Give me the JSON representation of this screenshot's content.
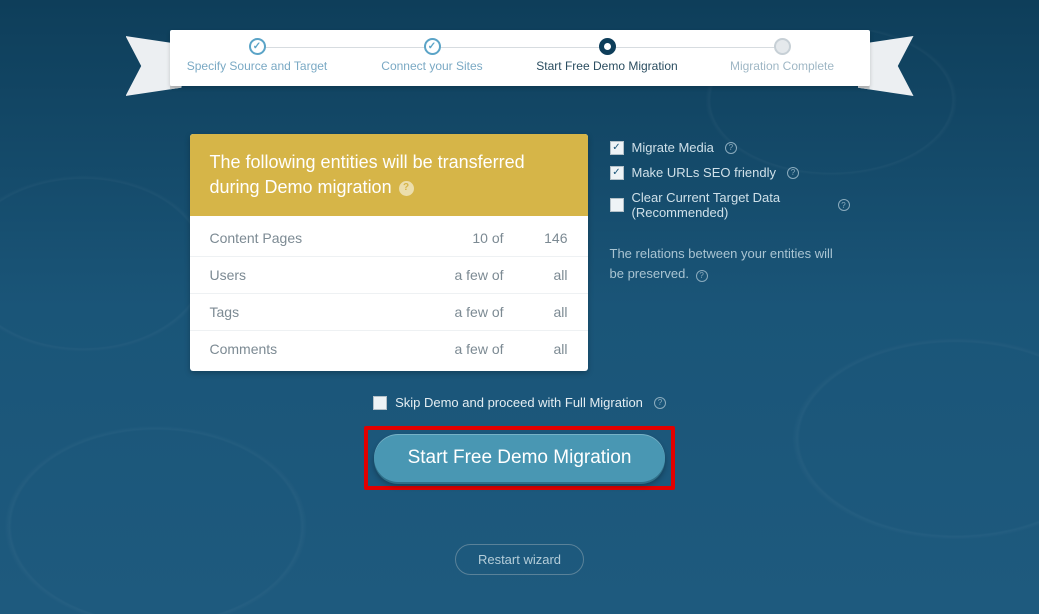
{
  "steps": [
    {
      "label": "Specify Source and Target",
      "state": "done"
    },
    {
      "label": "Connect your Sites",
      "state": "done"
    },
    {
      "label": "Start Free Demo Migration",
      "state": "current"
    },
    {
      "label": "Migration Complete",
      "state": "future"
    }
  ],
  "card": {
    "heading": "The following entities will be transferred during Demo migration",
    "rows": [
      {
        "name": "Content Pages",
        "qty": "10 of",
        "total": "146"
      },
      {
        "name": "Users",
        "qty": "a few of",
        "total": "all"
      },
      {
        "name": "Tags",
        "qty": "a few of",
        "total": "all"
      },
      {
        "name": "Comments",
        "qty": "a few of",
        "total": "all"
      }
    ]
  },
  "options": {
    "items": [
      {
        "label": "Migrate Media",
        "checked": true
      },
      {
        "label": "Make URLs SEO friendly",
        "checked": true
      },
      {
        "label": "Clear Current Target Data (Recommended)",
        "checked": false
      }
    ],
    "note": "The relations between your entities will be preserved."
  },
  "skip": {
    "label": "Skip Demo and proceed with Full Migration",
    "checked": false
  },
  "cta_label": "Start Free Demo Migration",
  "restart_label": "Restart wizard"
}
